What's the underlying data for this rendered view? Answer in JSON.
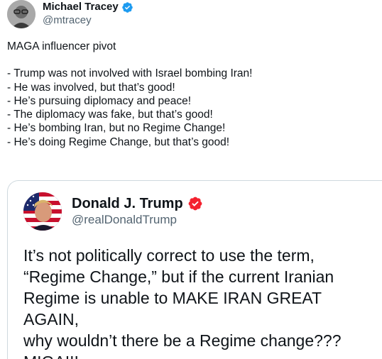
{
  "author": {
    "display_name": "Michael Tracey",
    "handle": "@mtracey"
  },
  "tweet": {
    "intro": "MAGA influencer pivot",
    "lines": [
      "- Trump was not involved with Israel bombing Iran!",
      "- He was involved, but that’s good!",
      "- He’s pursuing diplomacy and peace!",
      "- The diplomacy was fake, but that’s good!",
      "- He’s bombing Iran, but no Regime Change!",
      "- He’s doing Regime Change, but that’s good!"
    ]
  },
  "quoted": {
    "display_name": "Donald J. Trump",
    "handle": "@realDonaldTrump",
    "lines": [
      "It’s not politically correct to use the term,",
      "“Regime Change,” but if the current Iranian",
      "Regime is unable to MAKE IRAN GREAT AGAIN,",
      "why wouldn’t there be a Regime change???",
      "MIGA!!!"
    ]
  },
  "colors": {
    "verified_blue": "#1d9bf0",
    "verified_red": "#f4212e",
    "handle_gray": "#536471"
  },
  "icons": {
    "author_badge": "verified-badge-icon",
    "quoted_badge": "verified-badge-icon"
  }
}
